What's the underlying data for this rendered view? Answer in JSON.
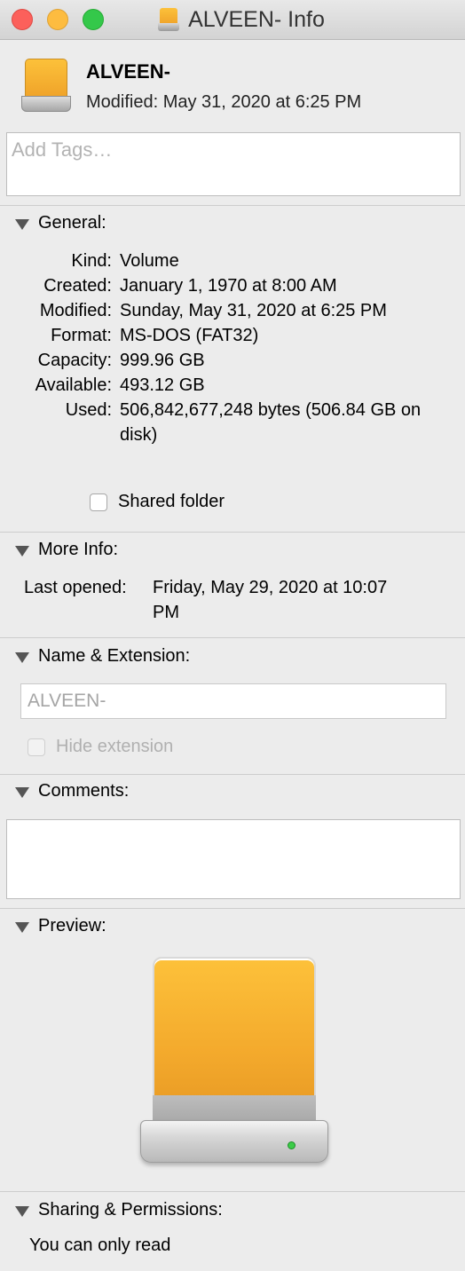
{
  "window": {
    "title": "ALVEEN- Info"
  },
  "header": {
    "name": "ALVEEN-",
    "modified": "Modified: May 31, 2020 at 6:25 PM"
  },
  "tags": {
    "placeholder": "Add Tags…"
  },
  "general": {
    "label": "General:",
    "rows": [
      {
        "key": "Kind:",
        "value": "Volume"
      },
      {
        "key": "Created:",
        "value": "January 1, 1970 at 8:00 AM"
      },
      {
        "key": "Modified:",
        "value": "Sunday, May 31, 2020 at 6:25 PM"
      },
      {
        "key": "Format:",
        "value": "MS-DOS (FAT32)"
      },
      {
        "key": "Capacity:",
        "value": "999.96 GB"
      },
      {
        "key": "Available:",
        "value": "493.12 GB"
      },
      {
        "key": "Used:",
        "value": "506,842,677,248 bytes (506.84 GB on disk)"
      }
    ],
    "shared_folder_label": "Shared folder",
    "shared_folder_checked": false
  },
  "more_info": {
    "label": "More Info:",
    "last_opened_key": "Last opened:",
    "last_opened_value": "Friday, May 29, 2020 at 10:07 PM"
  },
  "name_extension": {
    "label": "Name & Extension:",
    "value": "ALVEEN-",
    "hide_extension_label": "Hide extension",
    "hide_extension_checked": false
  },
  "comments": {
    "label": "Comments:",
    "value": ""
  },
  "preview": {
    "label": "Preview:",
    "icon": "external-drive-icon"
  },
  "sharing": {
    "label": "Sharing & Permissions:",
    "text": "You can only read"
  },
  "colors": {
    "close": "#fc605b",
    "minimize": "#fdbc40",
    "zoom": "#34c84a",
    "drive_orange": "#f3a92c"
  }
}
